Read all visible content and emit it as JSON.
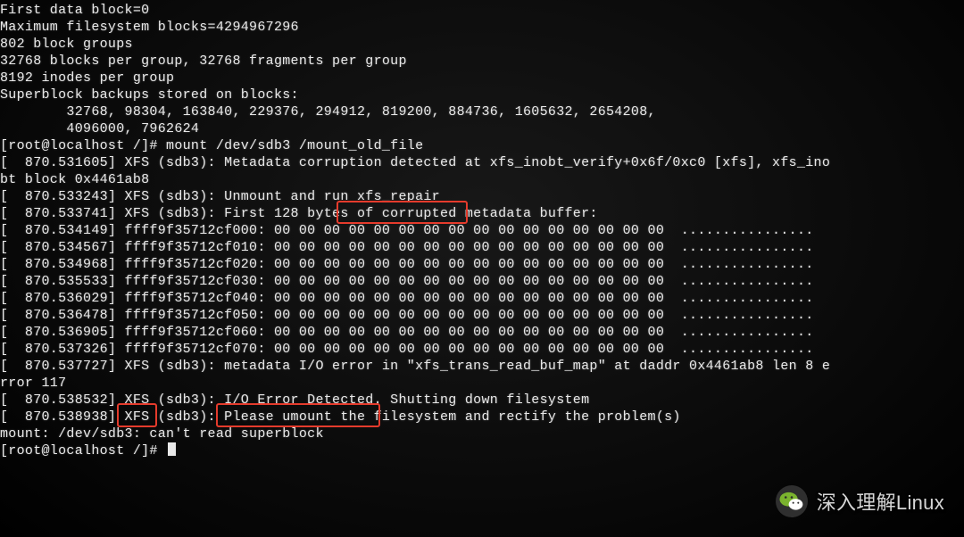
{
  "highlights": {
    "hl1": {
      "target": "run xfs_repair"
    },
    "hl2": {
      "target": "XFS"
    },
    "hl3": {
      "target": "I/O Error Detected."
    }
  },
  "watermark": {
    "text": "深入理解Linux"
  },
  "terminal": {
    "lines": [
      "First data block=0",
      "Maximum filesystem blocks=4294967296",
      "802 block groups",
      "32768 blocks per group, 32768 fragments per group",
      "8192 inodes per group",
      "Superblock backups stored on blocks:",
      "        32768, 98304, 163840, 229376, 294912, 819200, 884736, 1605632, 2654208,",
      "        4096000, 7962624",
      "",
      "[root@localhost /]# mount /dev/sdb3 /mount_old_file",
      "[  870.531605] XFS (sdb3): Metadata corruption detected at xfs_inobt_verify+0x6f/0xc0 [xfs], xfs_ino",
      "bt block 0x4461ab8",
      "[  870.533243] XFS (sdb3): Unmount and run xfs_repair",
      "[  870.533741] XFS (sdb3): First 128 bytes of corrupted metadata buffer:",
      "[  870.534149] ffff9f35712cf000: 00 00 00 00 00 00 00 00 00 00 00 00 00 00 00 00  ................",
      "[  870.534567] ffff9f35712cf010: 00 00 00 00 00 00 00 00 00 00 00 00 00 00 00 00  ................",
      "[  870.534968] ffff9f35712cf020: 00 00 00 00 00 00 00 00 00 00 00 00 00 00 00 00  ................",
      "[  870.535533] ffff9f35712cf030: 00 00 00 00 00 00 00 00 00 00 00 00 00 00 00 00  ................",
      "[  870.536029] ffff9f35712cf040: 00 00 00 00 00 00 00 00 00 00 00 00 00 00 00 00  ................",
      "[  870.536478] ffff9f35712cf050: 00 00 00 00 00 00 00 00 00 00 00 00 00 00 00 00  ................",
      "[  870.536905] ffff9f35712cf060: 00 00 00 00 00 00 00 00 00 00 00 00 00 00 00 00  ................",
      "[  870.537326] ffff9f35712cf070: 00 00 00 00 00 00 00 00 00 00 00 00 00 00 00 00  ................",
      "[  870.537727] XFS (sdb3): metadata I/O error in \"xfs_trans_read_buf_map\" at daddr 0x4461ab8 len 8 e",
      "rror 117",
      "[  870.538532] XFS (sdb3): I/O Error Detected. Shutting down filesystem",
      "[  870.538938] XFS (sdb3): Please umount the filesystem and rectify the problem(s)",
      "mount: /dev/sdb3: can't read superblock",
      "[root@localhost /]# "
    ]
  }
}
